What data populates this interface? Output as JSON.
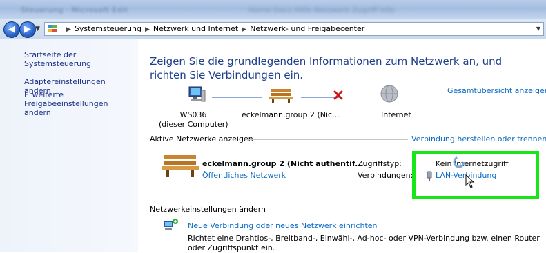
{
  "window": {
    "title_blurred": "Steuerung · Microsoft Edit",
    "title_right_blurred": "Home   Docs   Hilfe   Netzwerk   Zugriff   Info"
  },
  "address_bar": {
    "breadcrumbs": [
      "Systemsteuerung",
      "Netzwerk und Internet",
      "Netzwerk- und Freigabecenter"
    ]
  },
  "sidebar": {
    "items": [
      {
        "label": "Startseite der Systemsteuerung"
      },
      {
        "label": "Adaptereinstellungen ändern"
      },
      {
        "label": "Erweiterte Freigabeeinstellungen ändern"
      }
    ]
  },
  "main": {
    "headline": "Zeigen Sie die grundlegenden Informationen zum Netzwerk an, und richten Sie Verbindungen ein.",
    "overview_link": "Gesamtübersicht anzeigen",
    "map": {
      "computer_name": "WS036",
      "computer_sub": "(dieser Computer)",
      "network_name": "eckelmann.group  2 (Nic...",
      "internet_label": "Internet"
    },
    "active_networks": {
      "section_label": "Aktive Netzwerke anzeigen",
      "connect_link": "Verbindung herstellen oder trennen",
      "network_title": "eckelmann.group  2 (Nicht authentif...",
      "network_type_link": "Öffentliches Netzwerk",
      "access_type_label": "Zugriffstyp:",
      "access_type_value": "Kein Internetzugriff",
      "connections_label": "Verbindungen:",
      "connections_value": "LAN-Verbindung"
    },
    "settings": {
      "section_label": "Netzwerkeinstellungen ändern",
      "new_connection_link": "Neue Verbindung oder neues Netzwerk einrichten",
      "new_connection_desc": "Richtet eine Drahtlos-, Breitband-, Einwähl-, Ad-hoc- oder VPN-Verbindung bzw. einen Router oder Zugriffspunkt ein."
    }
  },
  "colors": {
    "link": "#0b6cc4",
    "headline": "#1e3f8c",
    "sidebar_link": "#1e3287",
    "highlight": "#19e619"
  }
}
